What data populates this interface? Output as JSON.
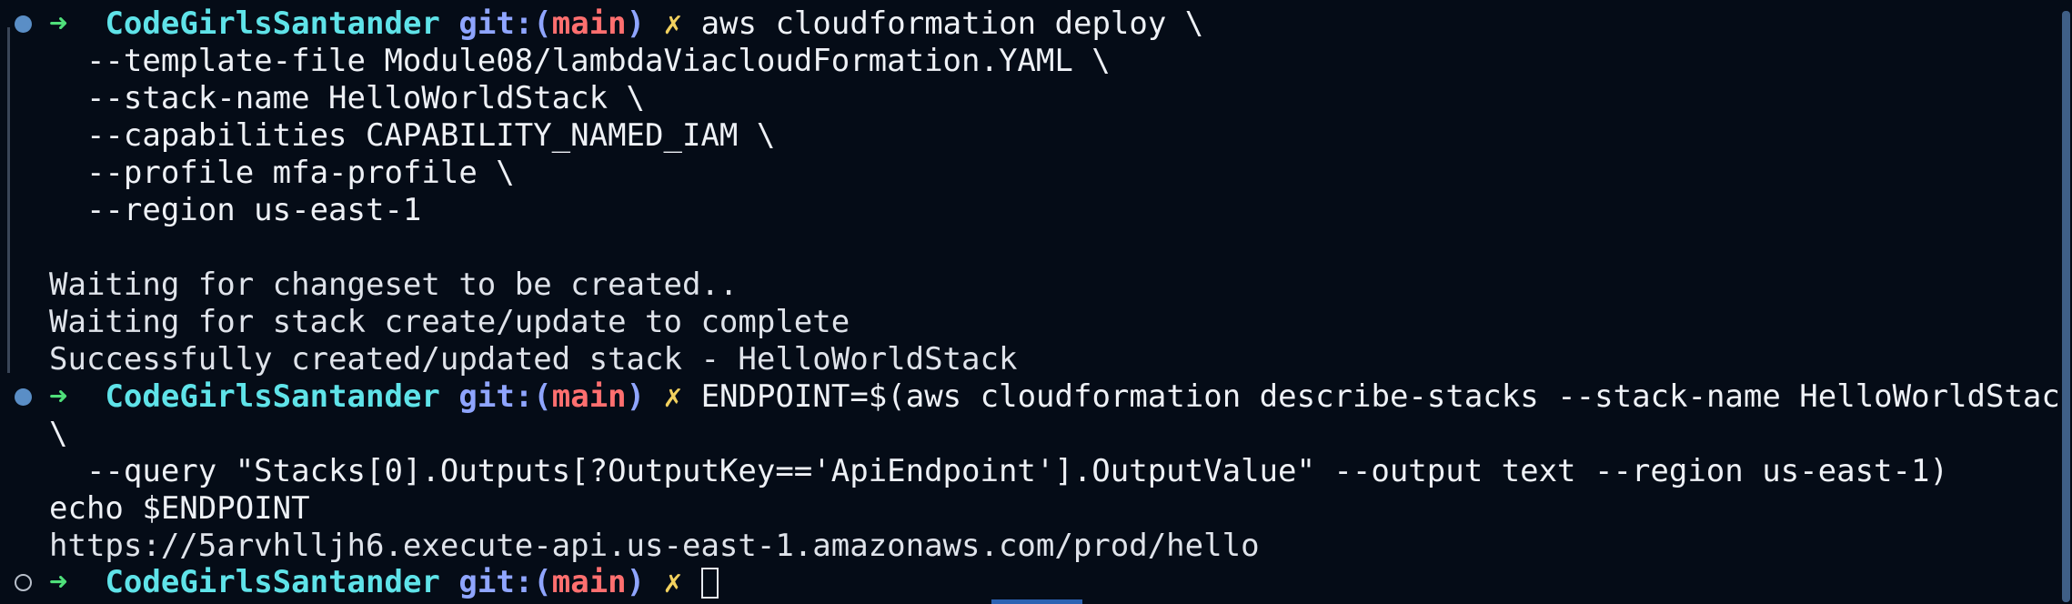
{
  "prompt": {
    "arrow": "➜",
    "directory": "CodeGirlsSantander",
    "git_prefix": "git:(",
    "branch": "main",
    "git_suffix": ")",
    "dirty_mark": "✗"
  },
  "blocks": [
    {
      "command_lines": [
        "aws cloudformation deploy \\",
        "  --template-file Module08/lambdaViacloudFormation.YAML \\",
        "  --stack-name HelloWorldStack \\",
        "  --capabilities CAPABILITY_NAMED_IAM \\",
        "  --profile mfa-profile \\",
        "  --region us-east-1"
      ],
      "output_lines": [
        "Waiting for changeset to be created..",
        "Waiting for stack create/update to complete",
        "Successfully created/updated stack - HelloWorldStack"
      ]
    },
    {
      "command_lines": [
        "ENDPOINT=$(aws cloudformation describe-stacks --stack-name HelloWorldStack",
        "\\",
        "  --query \"Stacks[0].Outputs[?OutputKey=='ApiEndpoint'].OutputValue\" --output text --region us-east-1)",
        "echo $ENDPOINT"
      ],
      "output_lines": [
        "https://5arvhlljh6.execute-api.us-east-1.amazonaws.com/prod/hello"
      ]
    }
  ],
  "colors": {
    "background": "#050c17",
    "arrow": "#4fe07a",
    "directory": "#5fe3e9",
    "git": "#8fa5ff",
    "branch": "#ff6f6f",
    "dirty": "#f2d15e",
    "text": "#dfe3ea"
  }
}
